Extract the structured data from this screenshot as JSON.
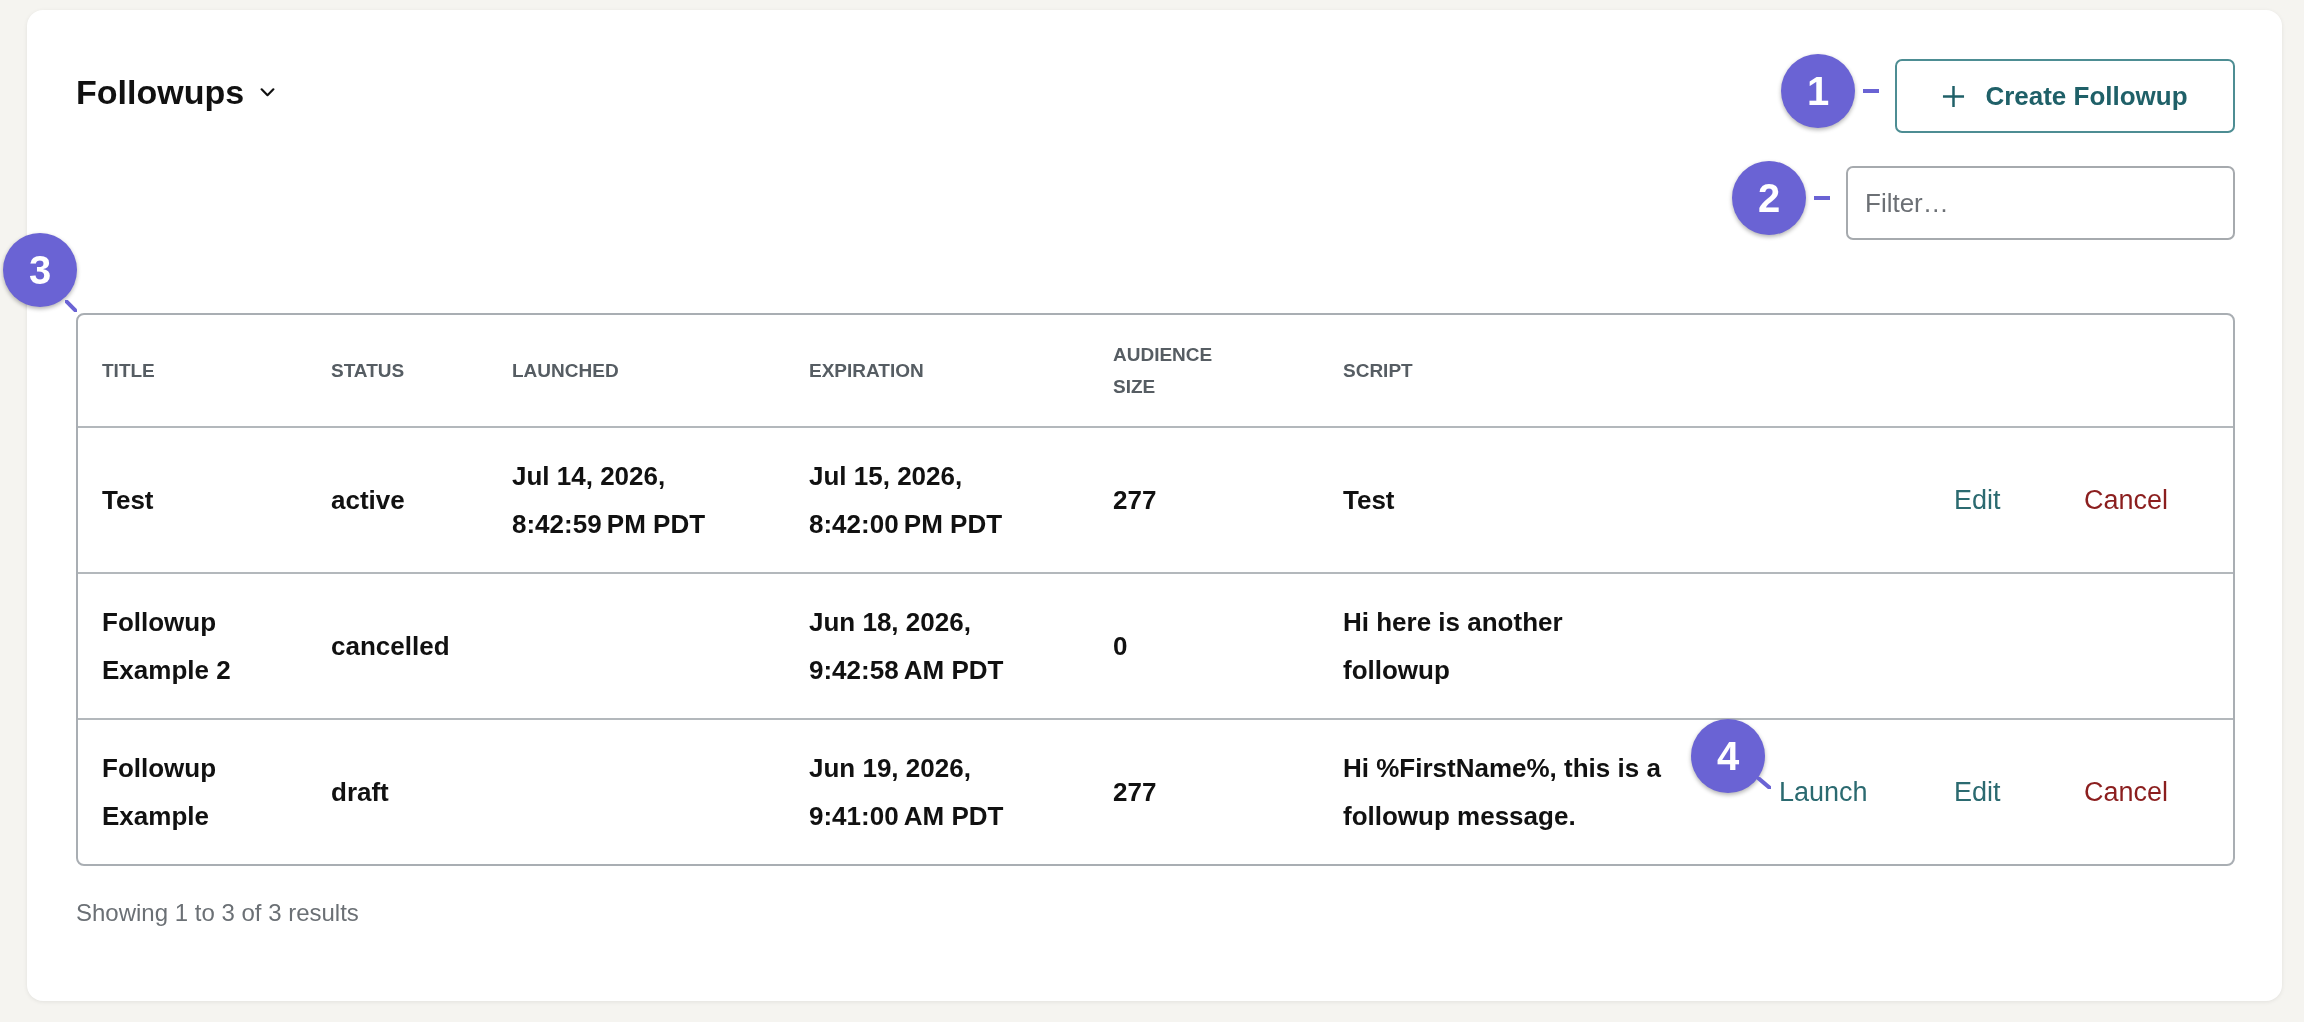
{
  "page": {
    "title": "Followups"
  },
  "create_button": {
    "label": "Create Followup",
    "callout": "1"
  },
  "filter": {
    "placeholder": "Filter…",
    "callout": "2"
  },
  "table": {
    "callout": "3",
    "columns": [
      "TITLE",
      "STATUS",
      "LAUNCHED",
      "EXPIRATION",
      "AUDIENCE SIZE",
      "SCRIPT"
    ],
    "rows": [
      {
        "title": "Test",
        "status": "active",
        "launched": "Jul 14, 2026, 8:42:59 PM PDT",
        "expiration": "Jul 15, 2026, 8:42:00 PM PDT",
        "audience_size": "277",
        "script": "Test",
        "actions": [
          {
            "kind": "edit",
            "label": "Edit"
          },
          {
            "kind": "cancel",
            "label": "Cancel"
          }
        ]
      },
      {
        "title": "Followup Example 2",
        "status": "cancelled",
        "expiration": "Jun 18, 2026, 9:42:58 AM PDT",
        "audience_size": "0",
        "script": "Hi here is another followup"
      },
      {
        "title": "Followup Example",
        "status": "draft",
        "expiration": "Jun 19, 2026, 9:41:00 AM PDT",
        "audience_size": "277",
        "script": "Hi %FirstName%, this is a followup message.",
        "actions": [
          {
            "kind": "launch",
            "label": "Launch",
            "callout": "4"
          },
          {
            "kind": "edit",
            "label": "Edit"
          },
          {
            "kind": "cancel",
            "label": "Cancel"
          }
        ]
      }
    ]
  },
  "footer": {
    "summary": "Showing 1 to 3 of 3 results"
  }
}
